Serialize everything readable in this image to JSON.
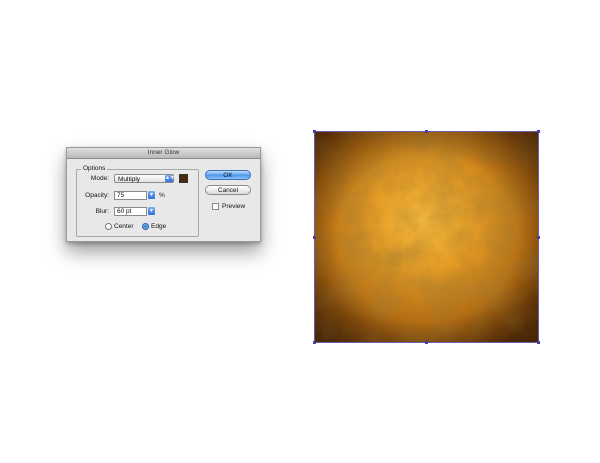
{
  "dialog": {
    "title": "Inner Glow",
    "options_legend": "Options",
    "mode": {
      "label": "Mode:",
      "value": "Multiply",
      "glow_color": "#4a2a08"
    },
    "opacity": {
      "label": "Opacity:",
      "value": "75",
      "unit": "%"
    },
    "blur": {
      "label": "Blur:",
      "value": "60 pt"
    },
    "source": {
      "center_label": "Center",
      "edge_label": "Edge",
      "selected": "Edge"
    },
    "buttons": {
      "ok": "OK",
      "cancel": "Cancel"
    },
    "preview": {
      "label": "Preview",
      "checked": false
    }
  },
  "artwork": {
    "description_colors": {
      "center": "#f2b03a",
      "edge": "#5a3006",
      "selection": "#6a5bb0"
    }
  }
}
